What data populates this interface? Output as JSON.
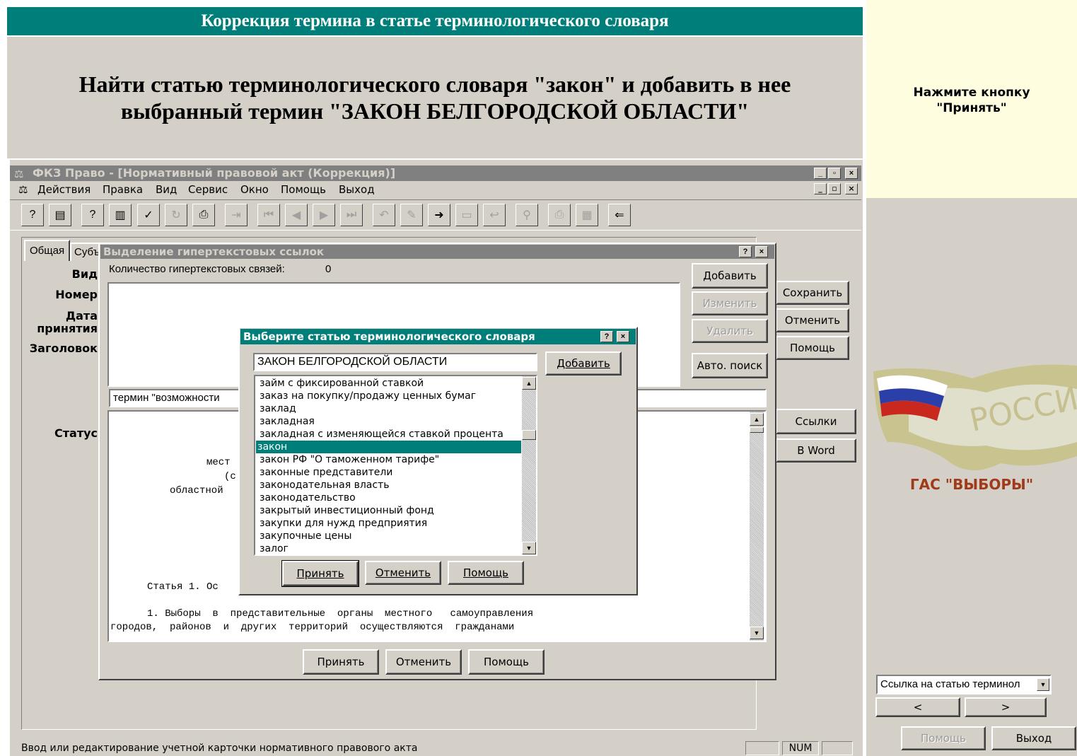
{
  "tutorial": {
    "banner_title": "Коррекция термина в статье терминологического словаря",
    "task_line1": "Найти статью терминологического словаря \"закон\" и добавить в нее",
    "task_line2": "выбранный термин \"ЗАКОН БЕЛГОРОДСКОЙ ОБЛАСТИ\"",
    "hint_line1": "Нажмите кнопку",
    "hint_line2": "\"Принять\"",
    "logo_caption": "ГАС \"ВЫБОРЫ\"",
    "logo_watermark": "РОССИЯ",
    "nav_select": "Ссылка на статью терминол",
    "prev_label": "<",
    "next_label": ">",
    "help_label": "Помощь",
    "exit_label": "Выход"
  },
  "app": {
    "title": "ФКЗ Право - [Нормативный правовой акт (Коррекция)]",
    "menu": [
      "Действия",
      "Правка",
      "Вид",
      "Сервис",
      "Окно",
      "Помощь",
      "Выход"
    ],
    "tabs": [
      "Общая",
      "Субъ"
    ],
    "labels": {
      "vid": "Вид",
      "nomer": "Номер",
      "data1": "Дата",
      "data2": "принятия",
      "zagolovok": "Заголовок",
      "status": "Статус"
    },
    "side_buttons": {
      "save": "Сохранить",
      "cancel": "Отменить",
      "help": "Помощь",
      "links": "Ссылки",
      "word": "В Word"
    },
    "status_text": "Ввод или редактирование учетной карточки нормативного правового акта",
    "status_num": "NUM"
  },
  "hyperlink_dialog": {
    "title": "Выделение гипертекстовых ссылок",
    "count_label": "Количество гипертекстовых связей:",
    "count_value": "0",
    "add": "Добавить",
    "edit": "Изменить",
    "delete": "Удалить",
    "auto_search": "Авто. поиск",
    "term_field": "термин \"возможности",
    "doc_lines": [
      "мест",
      "(с",
      "областной",
      "Статья 1. Ос",
      "1. Выборы  в  представительные  органы  местного   самоуправления",
      "городов,  районов  и  других  территорий  осуществляются  гражданами"
    ],
    "accept": "Принять",
    "cancel": "Отменить",
    "help": "Помощь"
  },
  "term_dialog": {
    "title": "Выберите статью терминологического словаря",
    "input_value": "ЗАКОН БЕЛГОРОДСКОЙ ОБЛАСТИ",
    "add": "Добавить",
    "items": [
      "займ с фиксированной ставкой",
      "заказ на покупку/продажу ценных бумаг",
      "заклад",
      "закладная",
      "закладная с изменяющейся ставкой процента",
      "закон",
      "закон РФ \"О таможенном тарифе\"",
      "законные представители",
      "законодательная власть",
      "законодательство",
      "закрытый инвестиционный     фонд",
      "закупки для   нужд   предприятия",
      "закупочные цены",
      "залог"
    ],
    "selected_index": 5,
    "accept": "Принять",
    "cancel": "Отменить",
    "help": "Помощь"
  }
}
